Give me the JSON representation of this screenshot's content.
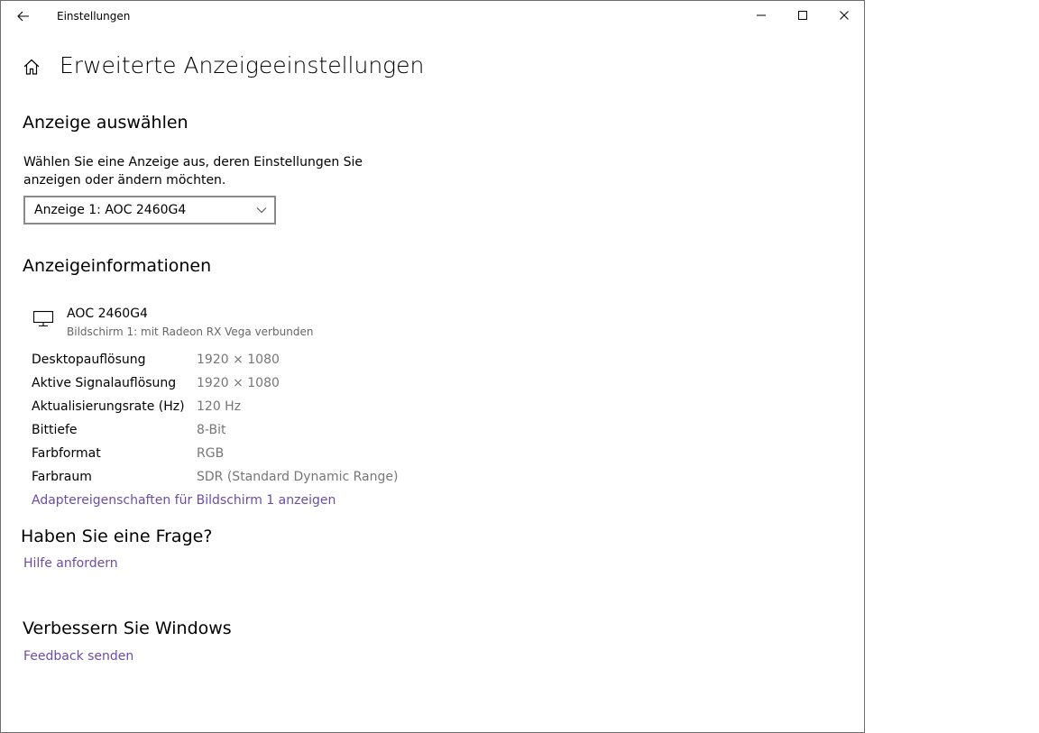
{
  "titlebar": {
    "app_title": "Einstellungen",
    "back_icon": "arrow-left-icon",
    "minimize_icon": "minimize-icon",
    "maximize_icon": "maximize-icon",
    "close_icon": "close-icon"
  },
  "header": {
    "home_icon": "home-icon",
    "title": "Erweiterte Anzeigeeinstellungen"
  },
  "display_select": {
    "heading": "Anzeige auswählen",
    "description": "Wählen Sie eine Anzeige aus, deren Einstellungen Sie anzeigen oder ändern möchten.",
    "selected": "Anzeige 1: AOC 2460G4"
  },
  "display_info": {
    "heading": "Anzeigeinformationen",
    "monitor_icon": "monitor-icon",
    "monitor_name": "AOC 2460G4",
    "monitor_subtitle": "Bildschirm 1: mit Radeon RX Vega verbunden",
    "rows": [
      {
        "label": "Desktopauflösung",
        "value": "1920 × 1080"
      },
      {
        "label": "Aktive Signalauflösung",
        "value": "1920 × 1080"
      },
      {
        "label": "Aktualisierungsrate (Hz)",
        "value": "120 Hz"
      },
      {
        "label": "Bittiefe",
        "value": "8-Bit"
      },
      {
        "label": "Farbformat",
        "value": "RGB"
      },
      {
        "label": "Farbraum",
        "value": "SDR (Standard Dynamic Range)"
      }
    ],
    "adapter_link": "Adaptereigenschaften für Bildschirm 1 anzeigen"
  },
  "faq": {
    "heading": "Haben Sie eine Frage?",
    "link": "Hilfe anfordern"
  },
  "improve": {
    "heading": "Verbessern Sie Windows",
    "link": "Feedback senden"
  },
  "colors": {
    "link": "#6b4da6",
    "secondary_text": "#767676",
    "border": "#8a8a8a"
  }
}
